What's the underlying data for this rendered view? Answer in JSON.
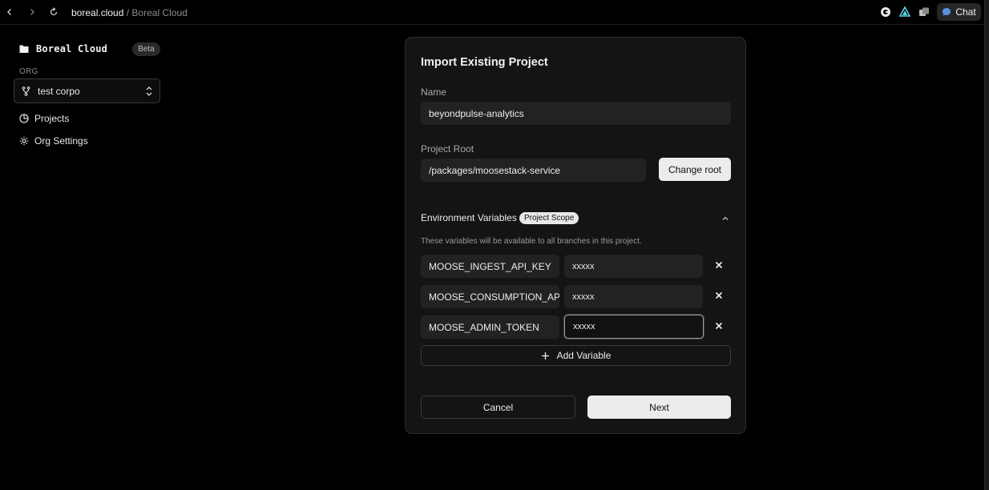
{
  "browser": {
    "url_host": "boreal.cloud",
    "url_separator": "/",
    "url_page": "Boreal Cloud",
    "chat_label": "Chat"
  },
  "sidebar": {
    "brand": "Boreal Cloud",
    "badge": "Beta",
    "org_label": "ORG",
    "org_selected": "test corpo",
    "items": [
      {
        "label": "Projects",
        "icon": "projects-icon"
      },
      {
        "label": "Org Settings",
        "icon": "gear-icon"
      }
    ]
  },
  "modal": {
    "title": "Import Existing Project",
    "name_label": "Name",
    "name_value": "beyondpulse-analytics",
    "root_label": "Project Root",
    "root_value": "/packages/moosestack-service",
    "change_root_label": "Change root",
    "env_title": "Environment Variables",
    "env_scope": "Project Scope",
    "env_desc": "These variables will be available to all branches in this project.",
    "env_vars": [
      {
        "key": "MOOSE_INGEST_API_KEY",
        "value": "xxxxx"
      },
      {
        "key": "MOOSE_CONSUMPTION_API_",
        "value": "xxxxx"
      },
      {
        "key": "MOOSE_ADMIN_TOKEN",
        "value": "xxxxx"
      }
    ],
    "add_variable_label": "Add Variable",
    "cancel_label": "Cancel",
    "next_label": "Next"
  }
}
